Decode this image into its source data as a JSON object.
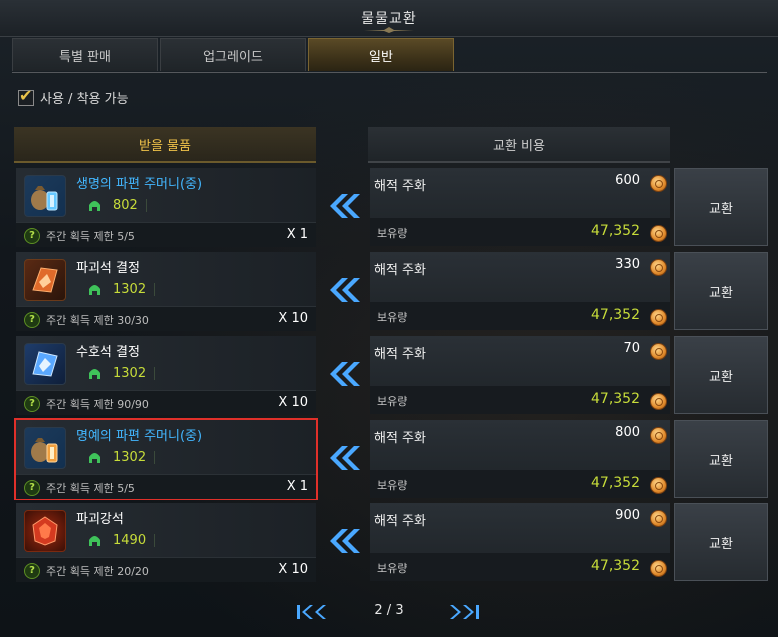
{
  "window": {
    "title": "물물교환"
  },
  "tabs": [
    {
      "label": "특별 판매",
      "active": false
    },
    {
      "label": "업그레이드",
      "active": false
    },
    {
      "label": "일반",
      "active": true
    }
  ],
  "filter": {
    "label": "사용 / 착용 가능",
    "checked": true
  },
  "headers": {
    "receive": "받을 물품",
    "cost": "교환 비용"
  },
  "rows": [
    {
      "name": "생명의 파편 주머니(중)",
      "name_color": "blue",
      "level": "802",
      "limit": "주간 획득 제한 5/5",
      "qty": "X 1",
      "cost_name": "해적 주화",
      "cost_price": "600",
      "hold_label": "보유량",
      "hold_value": "47,352",
      "button": "교환",
      "icon": "life-shard-pouch-icon"
    },
    {
      "name": "파괴석 결정",
      "name_color": "white",
      "level": "1302",
      "limit": "주간 획득 제한 30/30",
      "qty": "X 10",
      "cost_name": "해적 주화",
      "cost_price": "330",
      "hold_label": "보유량",
      "hold_value": "47,352",
      "button": "교환",
      "icon": "destruction-stone-crystal-icon"
    },
    {
      "name": "수호석 결정",
      "name_color": "white",
      "level": "1302",
      "limit": "주간 획득 제한 90/90",
      "qty": "X 10",
      "cost_name": "해적 주화",
      "cost_price": "70",
      "hold_label": "보유량",
      "hold_value": "47,352",
      "button": "교환",
      "icon": "guardian-stone-crystal-icon"
    },
    {
      "name": "명예의 파편 주머니(중)",
      "name_color": "blue",
      "level": "1302",
      "limit": "주간 획득 제한 5/5",
      "qty": "X 1",
      "cost_name": "해적 주화",
      "cost_price": "800",
      "hold_label": "보유량",
      "hold_value": "47,352",
      "button": "교환",
      "icon": "honor-shard-pouch-icon",
      "selected": true
    },
    {
      "name": "파괴강석",
      "name_color": "white",
      "level": "1490",
      "limit": "주간 획득 제한 20/20",
      "qty": "X 10",
      "cost_name": "해적 주화",
      "cost_price": "900",
      "hold_label": "보유량",
      "hold_value": "47,352",
      "button": "교환",
      "icon": "obliteration-stone-icon"
    }
  ],
  "pager": {
    "text": "2 / 3"
  },
  "colors": {
    "accent_gold": "#f0c24a",
    "level_green": "#c7dc3a",
    "item_blue": "#43b7ff",
    "selection_red": "#e0302a"
  }
}
